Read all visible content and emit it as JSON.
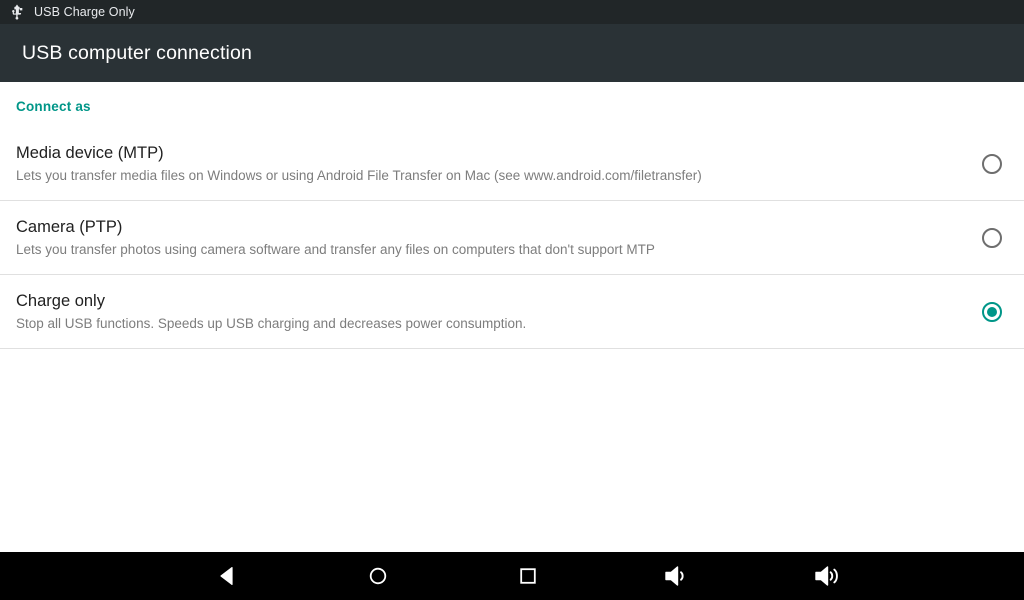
{
  "status_bar": {
    "usb_icon": "usb-icon",
    "text": "USB Charge Only"
  },
  "action_bar": {
    "title": "USB computer connection"
  },
  "content": {
    "section_header": "Connect as",
    "options": [
      {
        "title": "Media device (MTP)",
        "description": "Lets you transfer media files on Windows or using Android File Transfer on Mac (see www.android.com/filetransfer)",
        "selected": false
      },
      {
        "title": "Camera (PTP)",
        "description": "Lets you transfer photos using camera software and transfer any files on computers that don't support MTP",
        "selected": false
      },
      {
        "title": "Charge only",
        "description": "Stop all USB functions. Speeds up USB charging and decreases power consumption.",
        "selected": true
      }
    ]
  },
  "nav_bar": {
    "buttons": [
      {
        "name": "back-icon",
        "label": "Back"
      },
      {
        "name": "home-icon",
        "label": "Home"
      },
      {
        "name": "recents-icon",
        "label": "Recents"
      },
      {
        "name": "volume-down-icon",
        "label": "Volume down"
      },
      {
        "name": "volume-up-icon",
        "label": "Volume up"
      }
    ]
  },
  "colors": {
    "status_bar_bg": "#212628",
    "action_bar_bg": "#2a3236",
    "accent_teal": "#009688",
    "title_text": "#212121",
    "desc_text": "#7d7d7d",
    "divider": "#e0e0e0",
    "nav_bar_bg": "#000000"
  }
}
